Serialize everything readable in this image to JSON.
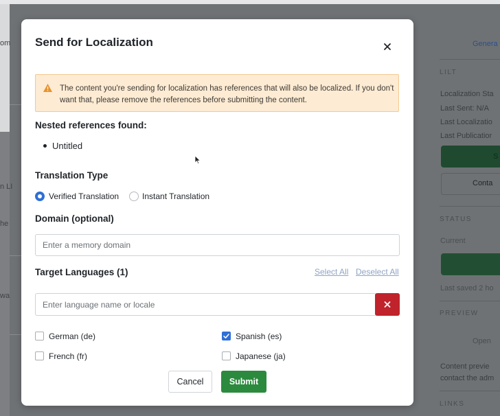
{
  "background": {
    "left_fragments": [
      "om",
      "n LI",
      "he",
      "wa"
    ],
    "side_panel": {
      "tab_general": "Genera",
      "section_lilt": "LILT",
      "lilt_rows": [
        "Localization Sta",
        "Last Sent: N/A",
        "Last Localizatio",
        "Last Publicatior"
      ],
      "green_button_fragment": "S",
      "contact_button_fragment": "Conta",
      "section_status": "STATUS",
      "status_current": "Current",
      "last_saved": "Last saved 2 ho",
      "section_preview": "PREVIEW",
      "preview_open": "Open",
      "preview_desc_1": "Content previe",
      "preview_desc_2": "contact the adm",
      "section_links": "LINKS"
    }
  },
  "modal": {
    "title": "Send for Localization",
    "close_icon": "close-icon",
    "warning": {
      "icon": "warning-triangle-icon",
      "text": "The content you're sending for localization has references that will also be localized. If you don't want that, please remove the references before submitting the content."
    },
    "nested_references": {
      "label": "Nested references found:",
      "items": [
        "Untitled"
      ]
    },
    "translation_type": {
      "label": "Translation Type",
      "options": [
        {
          "label": "Verified Translation",
          "selected": true
        },
        {
          "label": "Instant Translation",
          "selected": false
        }
      ]
    },
    "domain": {
      "label": "Domain (optional)",
      "placeholder": "Enter a memory domain",
      "value": ""
    },
    "target_languages": {
      "label": "Target Languages (1)",
      "select_all": "Select All",
      "deselect_all": "Deselect All",
      "placeholder": "Enter language name or locale",
      "value": "",
      "clear_icon": "close-icon",
      "languages": [
        {
          "label": "German (de)",
          "checked": false
        },
        {
          "label": "Spanish (es)",
          "checked": true
        },
        {
          "label": "French (fr)",
          "checked": false
        },
        {
          "label": "Japanese (ja)",
          "checked": false
        }
      ]
    },
    "buttons": {
      "cancel": "Cancel",
      "submit": "Submit"
    },
    "colors": {
      "primary": "#2f6fd6",
      "submit": "#2c8a3e",
      "danger": "#c0232b",
      "warning_bg": "#fdebd3",
      "warning_icon": "#e8922c"
    }
  }
}
